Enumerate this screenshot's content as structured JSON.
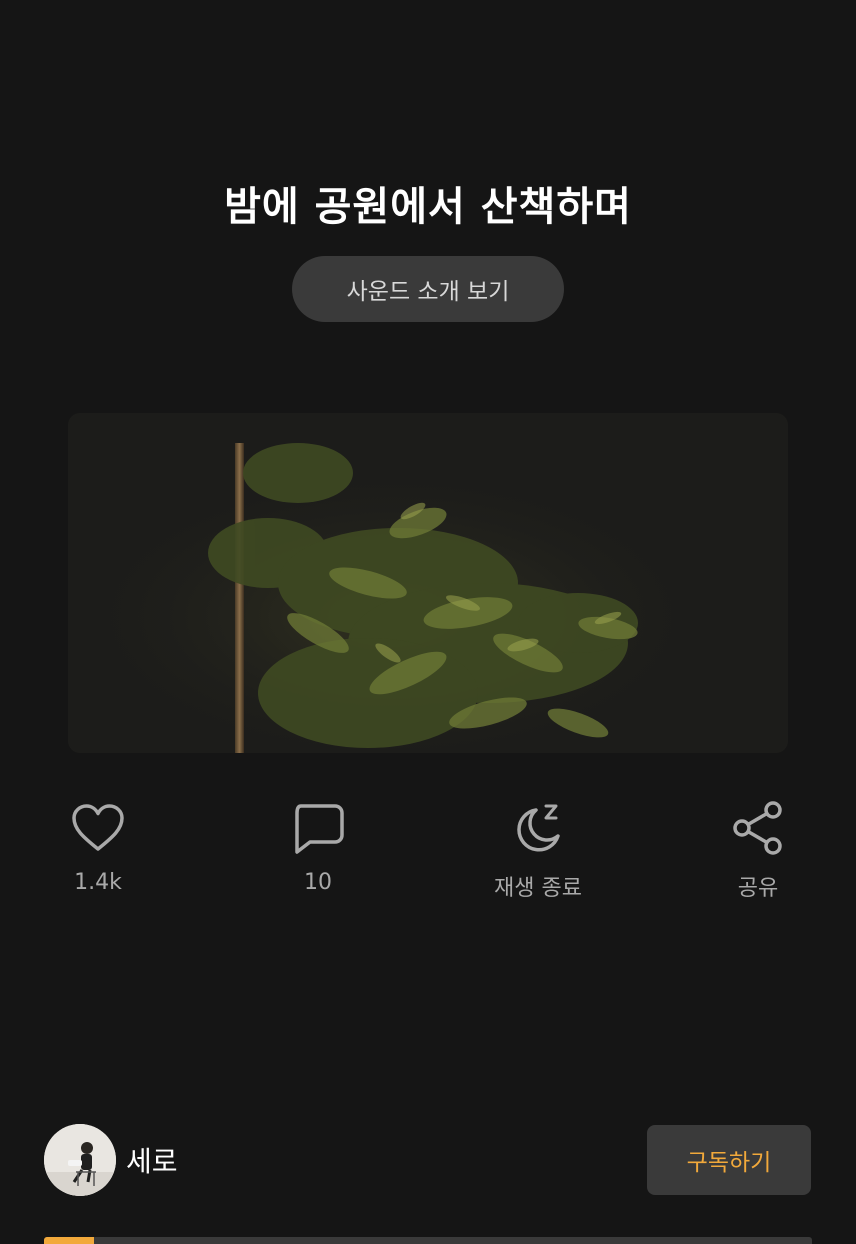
{
  "header": {
    "title": "밤에 공원에서 산책하며",
    "intro_button_label": "사운드 소개 보기"
  },
  "actions": [
    {
      "icon": "heart-icon",
      "label": "1.4k"
    },
    {
      "icon": "comment-icon",
      "label": "10"
    },
    {
      "icon": "sleep-timer-icon",
      "label": "재생 종료"
    },
    {
      "icon": "share-icon",
      "label": "공유"
    }
  ],
  "author": {
    "name": "세로",
    "subscribe_label": "구독하기"
  },
  "player": {
    "progress": 0.065
  },
  "colors": {
    "background": "#151515",
    "accent": "#f2a93b",
    "button_bg": "#3a3a3a",
    "muted_text": "#a9a9a9"
  }
}
